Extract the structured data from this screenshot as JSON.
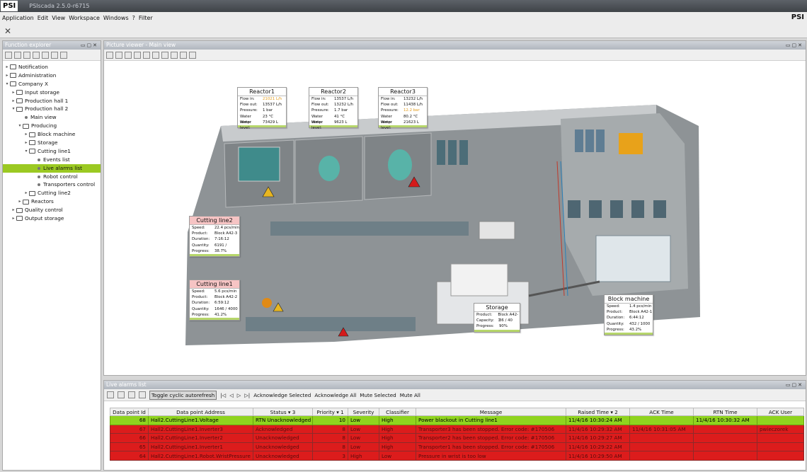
{
  "window": {
    "logo": "PSI",
    "title": "PSIscada 2.5.0-r6715"
  },
  "menu": [
    "Application",
    "Edit",
    "View",
    "Workspace",
    "Windows",
    "?",
    "Filter"
  ],
  "menu_logo": "PSI",
  "explorer": {
    "title": "Function explorer",
    "tree": [
      {
        "label": "Notification",
        "depth": 0,
        "kind": "folder",
        "arrow": "▸"
      },
      {
        "label": "Administration",
        "depth": 0,
        "kind": "folder",
        "arrow": "▸"
      },
      {
        "label": "Company X",
        "depth": 0,
        "kind": "folder",
        "arrow": "▾"
      },
      {
        "label": "Input storage",
        "depth": 1,
        "kind": "folder",
        "arrow": "▸"
      },
      {
        "label": "Production hall 1",
        "depth": 1,
        "kind": "folder",
        "arrow": "▸"
      },
      {
        "label": "Production hall 2",
        "depth": 1,
        "kind": "folder",
        "arrow": "▾"
      },
      {
        "label": "Main view",
        "depth": 2,
        "kind": "leaf",
        "arrow": ""
      },
      {
        "label": "Producing",
        "depth": 2,
        "kind": "folder",
        "arrow": "▾"
      },
      {
        "label": "Block machine",
        "depth": 3,
        "kind": "folder",
        "arrow": "▸"
      },
      {
        "label": "Storage",
        "depth": 3,
        "kind": "folder",
        "arrow": "▸"
      },
      {
        "label": "Cutting line1",
        "depth": 3,
        "kind": "folder",
        "arrow": "▾"
      },
      {
        "label": "Events list",
        "depth": 4,
        "kind": "leaf",
        "arrow": ""
      },
      {
        "label": "Live alarms list",
        "depth": 4,
        "kind": "leaf",
        "arrow": "",
        "selected": true
      },
      {
        "label": "Robot control",
        "depth": 4,
        "kind": "leaf",
        "arrow": ""
      },
      {
        "label": "Transporters control",
        "depth": 4,
        "kind": "leaf",
        "arrow": ""
      },
      {
        "label": "Cutting line2",
        "depth": 3,
        "kind": "folder",
        "arrow": "▸"
      },
      {
        "label": "Reactors",
        "depth": 2,
        "kind": "folder",
        "arrow": "▸"
      },
      {
        "label": "Quality control",
        "depth": 1,
        "kind": "folder",
        "arrow": "▸"
      },
      {
        "label": "Output storage",
        "depth": 1,
        "kind": "folder",
        "arrow": "▸"
      }
    ]
  },
  "viewer": {
    "title": "Picture viewer - Main view",
    "reactors": [
      {
        "name": "Reactor1",
        "rows": [
          [
            "Flow in:",
            "21021 L/h",
            true
          ],
          [
            "Flow out:",
            "13537 L/h",
            false
          ],
          [
            "Pressure:",
            "1 bar",
            false
          ],
          [
            "Water temp:",
            "23 °C",
            false
          ],
          [
            "Water level:",
            "73429 L",
            false
          ]
        ]
      },
      {
        "name": "Reactor2",
        "rows": [
          [
            "Flow in:",
            "13537 L/h",
            false
          ],
          [
            "Flow out:",
            "13232 L/h",
            false
          ],
          [
            "Pressure:",
            "1.7 bar",
            false
          ],
          [
            "Water temp:",
            "41 °C",
            false
          ],
          [
            "Water level:",
            "9623 L",
            false
          ]
        ]
      },
      {
        "name": "Reactor3",
        "rows": [
          [
            "Flow in:",
            "13232 L/h",
            false
          ],
          [
            "Flow out:",
            "11438 L/h",
            false
          ],
          [
            "Pressure:",
            "12.2 bar",
            true
          ],
          [
            "Water temp:",
            "80.2 °C",
            false
          ],
          [
            "Water level:",
            "21623 L",
            false
          ]
        ]
      }
    ],
    "cutting_line2": {
      "name": "Cutting line2",
      "rows": [
        [
          "Speed:",
          "22.4 pcs/min"
        ],
        [
          "Product:",
          "Block A42-3"
        ],
        [
          "Duration:",
          "7:16:12"
        ],
        [
          "Quantity:",
          "6191 /"
        ],
        [
          "Progress:",
          "38.7%"
        ]
      ]
    },
    "cutting_line1": {
      "name": "Cutting line1",
      "rows": [
        [
          "Speed:",
          "5.6 pcs/min"
        ],
        [
          "Product:",
          "Block A42-2"
        ],
        [
          "Duration:",
          "6:59:12"
        ],
        [
          "Quantity:",
          "1646 / 4000"
        ],
        [
          "Progress:",
          "41.2%"
        ]
      ]
    },
    "storage": {
      "name": "Storage",
      "rows": [
        [
          "Product:",
          "Block A42-1"
        ],
        [
          "Capacity:",
          "36 / 40"
        ],
        [
          "Progress:",
          "90%"
        ]
      ]
    },
    "block_machine": {
      "name": "Block machine",
      "rows": [
        [
          "Speed:",
          "1.4 pcs/min"
        ],
        [
          "Product:",
          "Block A42-1"
        ],
        [
          "Duration:",
          "6:44:12"
        ],
        [
          "Quantity:",
          "432 / 1000"
        ],
        [
          "Progress:",
          "43.2%"
        ]
      ]
    }
  },
  "alarms": {
    "title": "Live alarms list",
    "toggle": "Toggle cyclic autorefresh",
    "ack_selected": "Acknowledge Selected",
    "ack_all": "Acknowledge All",
    "mute_selected": "Mute Selected",
    "mute_all": "Mute All",
    "columns": [
      "Data point Id",
      "Data point Address",
      "Status ▾ 3",
      "Priority ▾ 1",
      "Severity",
      "Classifier",
      "Message",
      "Raised Time ▾ 2",
      "ACK Time",
      "RTN Time",
      "ACK User"
    ],
    "rows": [
      {
        "style": "green",
        "id": "68",
        "address": "Hall2.CuttingLine1.Voltage",
        "status": "RTN Unacknowledged",
        "priority": "10",
        "severity": "Low",
        "classifier": "High",
        "message": "Power blackout in Cutting line1",
        "raised": "11/4/16 10:30:24 AM",
        "ack": "",
        "rtn": "11/4/16 10:30:32 AM",
        "user": ""
      },
      {
        "style": "red",
        "id": "67",
        "address": "Hall2.CuttingLine1.Inverter3",
        "status": "Acknowledged",
        "priority": "8",
        "severity": "Low",
        "classifier": "High",
        "message": "Transporter3 has been stopped. Error code: #170506",
        "raised": "11/4/16 10:29:32 AM",
        "ack": "11/4/16 10:31:05 AM",
        "rtn": "",
        "user": "pwieczorek"
      },
      {
        "style": "red",
        "id": "66",
        "address": "Hall2.CuttingLine1.Inverter2",
        "status": "Unacknowledged",
        "priority": "8",
        "severity": "Low",
        "classifier": "High",
        "message": "Transporter2 has been stopped. Error code: #170506",
        "raised": "11/4/16 10:29:27 AM",
        "ack": "",
        "rtn": "",
        "user": ""
      },
      {
        "style": "red",
        "id": "65",
        "address": "Hall2.CuttingLine1.Inverter1",
        "status": "Unacknowledged",
        "priority": "8",
        "severity": "Low",
        "classifier": "High",
        "message": "Transporter1 has been stopped. Error code: #170506",
        "raised": "11/4/16 10:29:22 AM",
        "ack": "",
        "rtn": "",
        "user": ""
      },
      {
        "style": "red",
        "id": "64",
        "address": "Hall2.CuttingLine1.Robot.WristPressure",
        "status": "Unacknowledged",
        "priority": "3",
        "severity": "High",
        "classifier": "Low",
        "message": "Pressure in wrist is too low",
        "raised": "11/4/16 10:29:50 AM",
        "ack": "",
        "rtn": "",
        "user": ""
      }
    ]
  }
}
